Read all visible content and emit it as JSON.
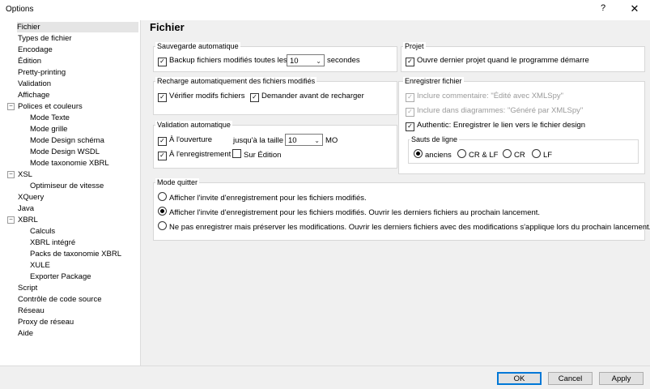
{
  "window": {
    "title": "Options",
    "help": "?",
    "close": "✕"
  },
  "tree": [
    "Fichier",
    "Types de fichier",
    "Encodage",
    "Édition",
    "Pretty-printing",
    "Validation",
    "Affichage",
    "Polices et couleurs",
    "Mode Texte",
    "Mode grille",
    "Mode Design schéma",
    "Mode Design WSDL",
    "Mode taxonomie XBRL",
    "XSL",
    "Optimiseur de vitesse",
    "XQuery",
    "Java",
    "XBRL",
    "Calculs",
    "XBRL intégré",
    "Packs de taxonomie XBRL",
    "XULE",
    "Exporter Package",
    "Script",
    "Contrôle de code source",
    "Réseau",
    "Proxy de réseau",
    "Aide"
  ],
  "page": {
    "heading": "Fichier"
  },
  "autosave": {
    "label": "Sauvegarde automatique",
    "backup": "Backup fichiers modifiés toutes les",
    "interval": "10",
    "unit": "secondes"
  },
  "reload": {
    "label": "Recharge automatiquement des fichiers modifiés",
    "verify": "Vérifier modifs fichiers",
    "ask": "Demander avant de recharger"
  },
  "validation": {
    "label": "Validation automatique",
    "on_open": "À l'ouverture",
    "up_to_size": "jusqu'à la taille",
    "size": "10",
    "size_unit": "MO",
    "on_save": "À l'enregistrement",
    "on_edit": "Sur Édition"
  },
  "project": {
    "label": "Projet",
    "open_last": "Ouvre dernier projet quand le programme démarre"
  },
  "save_file": {
    "label": "Enregistrer fichier",
    "include_comment": "Inclure commentaire: \"Édité avec XMLSpy\"",
    "include_diagrams": "Inclure dans diagrammes: \"Généré par XMLSpy\"",
    "authentic": "Authentic: Enregistrer le lien vers le fichier design"
  },
  "line_breaks": {
    "label": "Sauts de ligne",
    "options": [
      "anciens",
      "CR & LF",
      "CR",
      "LF"
    ]
  },
  "exit_mode": {
    "label": "Mode quitter",
    "options": [
      "Afficher l'invite d'enregistrement pour les fichiers modifiés.",
      "Afficher l'invite d'enregistrement pour les fichiers modifiés. Ouvrir les derniers fichiers au prochain lancement.",
      "Ne pas enregistrer mais préserver les modifications. Ouvrir les derniers fichiers avec des modifications s'applique lors du prochain lancement."
    ]
  },
  "buttons": {
    "ok": "OK",
    "cancel": "Cancel",
    "apply": "Apply"
  }
}
